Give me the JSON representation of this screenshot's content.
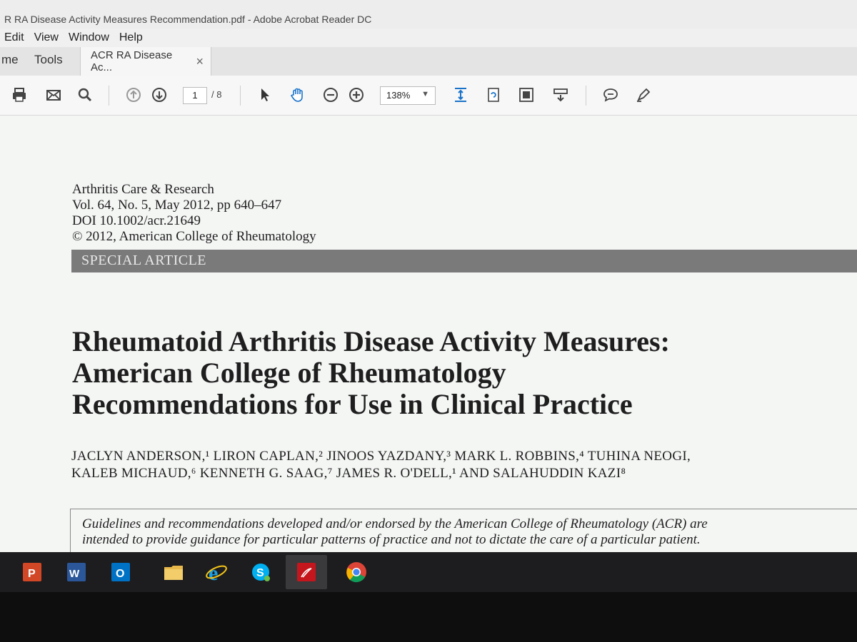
{
  "window": {
    "title": "R RA Disease Activity Measures Recommendation.pdf - Adobe Acrobat Reader DC"
  },
  "menu": {
    "items": [
      "Edit",
      "View",
      "Window",
      "Help"
    ]
  },
  "tabs": {
    "home": "me",
    "tools": "Tools",
    "document": "ACR RA Disease Ac...",
    "close": "×"
  },
  "toolbar": {
    "icons": [
      "print-icon",
      "email-icon",
      "search-icon",
      "prev-page-icon",
      "next-page-icon",
      "select-icon",
      "hand-icon",
      "zoom-out-icon",
      "zoom-in-icon",
      "fit-page-icon",
      "rotate-icon",
      "full-screen-icon",
      "scroll-mode-icon",
      "comment-icon",
      "sign-icon"
    ],
    "page_current": "1",
    "page_total": "/ 8",
    "zoom": "138%"
  },
  "document": {
    "journal": "Arthritis Care & Research",
    "volume": "Vol. 64, No. 5, May 2012, pp 640–647",
    "doi": "DOI 10.1002/acr.21649",
    "copyright": "© 2012, American College of Rheumatology",
    "section": "SPECIAL ARTICLE",
    "title_lines": [
      "Rheumatoid Arthritis Disease Activity Measures:",
      "American College of Rheumatology",
      "Recommendations for Use in Clinical Practice"
    ],
    "authors_lines": [
      "JACLYN ANDERSON,¹ LIRON CAPLAN,² JINOOS YAZDANY,³ MARK L. ROBBINS,⁴ TUHINA NEOGI,",
      "KALEB MICHAUD,⁶ KENNETH G. SAAG,⁷ JAMES R. O'DELL,¹ AND SALAHUDDIN KAZI⁸"
    ],
    "abstract_lines": [
      "Guidelines and recommendations developed and/or endorsed by the American College of Rheumatology (ACR) are",
      "intended to provide guidance for particular patterns of practice and not to dictate the care of a particular patient."
    ]
  },
  "taskbar": {
    "apps": [
      "powerpoint-icon",
      "word-icon",
      "outlook-icon",
      "file-explorer-icon",
      "internet-explorer-icon",
      "skype-icon",
      "acrobat-icon",
      "chrome-icon"
    ],
    "active_app": "acrobat-icon",
    "colors": {
      "powerpoint": "#d24726",
      "word": "#2b579a",
      "outlook": "#0072c6",
      "explorer": "#e8b84a",
      "ie": "#1ba1e2",
      "skype": "#00aff0",
      "acrobat": "#c4161c"
    }
  }
}
